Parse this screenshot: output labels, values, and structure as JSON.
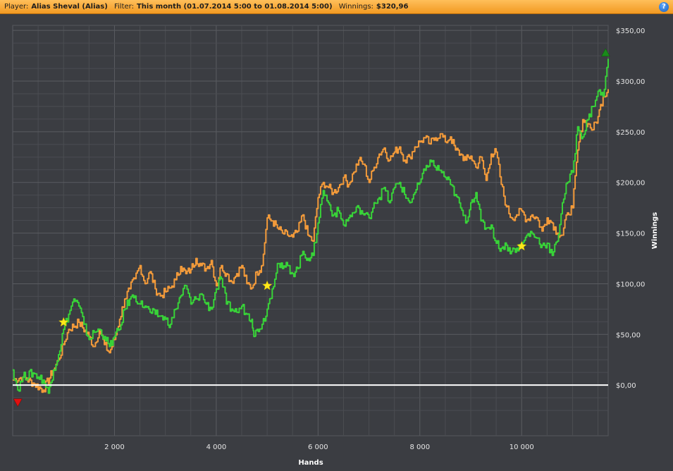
{
  "header": {
    "player_label": "Player:",
    "player_value": "Alias Sheval (Alias)",
    "filter_label": "Filter:",
    "filter_value": "This month (01.07.2014 5:00 to 01.08.2014 5:00)",
    "winnings_label": "Winnings:",
    "winnings_value": "$320,96",
    "help_icon": "?"
  },
  "colors": {
    "background": "#3b3d42",
    "grid": "#4b4d52",
    "orange_line": "#f29a3a",
    "green_line": "#38d238",
    "zero_line": "#ffffff",
    "star": "#ffe81a",
    "min_marker": "#e01010",
    "max_marker": "#1a8a1a"
  },
  "chart_data": {
    "type": "line",
    "xlabel": "Hands",
    "ylabel": "Winnings",
    "xlim": [
      0,
      11700
    ],
    "ylim": [
      -50,
      355
    ],
    "x_ticks": [
      2000,
      4000,
      6000,
      8000,
      10000
    ],
    "x_tick_labels": [
      "2 000",
      "4 000",
      "6 000",
      "8 000",
      "10 000"
    ],
    "y_ticks": [
      0,
      50,
      100,
      150,
      200,
      250,
      300,
      350
    ],
    "y_tick_labels": [
      "$0,00",
      "$50,00",
      "$100,00",
      "$150,00",
      "$200,00",
      "$250,00",
      "$300,00",
      "$350,00"
    ],
    "grid": true,
    "series": [
      {
        "color": "orange",
        "x": [
          0,
          200,
          400,
          600,
          800,
          900,
          1000,
          1100,
          1300,
          1500,
          1600,
          1700,
          1800,
          1900,
          2000,
          2100,
          2200,
          2300,
          2400,
          2500,
          2600,
          2700,
          2800,
          2900,
          3000,
          3100,
          3200,
          3300,
          3400,
          3500,
          3600,
          3700,
          3800,
          3900,
          4000,
          4100,
          4200,
          4300,
          4400,
          4500,
          4600,
          4700,
          4800,
          4850,
          4900,
          5000,
          5100,
          5200,
          5300,
          5400,
          5500,
          5600,
          5700,
          5800,
          5900,
          6000,
          6100,
          6200,
          6300,
          6400,
          6500,
          6600,
          6700,
          6800,
          6900,
          7000,
          7100,
          7200,
          7300,
          7400,
          7500,
          7600,
          7700,
          7800,
          7900,
          8000,
          8100,
          8200,
          8300,
          8400,
          8500,
          8600,
          8700,
          8800,
          8900,
          9000,
          9100,
          9200,
          9300,
          9400,
          9500,
          9600,
          9700,
          9800,
          9900,
          10000,
          10100,
          10200,
          10300,
          10400,
          10500,
          10600,
          10700,
          10800,
          10900,
          11000,
          11100,
          11200,
          11300,
          11400,
          11500,
          11600,
          11700
        ],
        "y": [
          5,
          8,
          2,
          -5,
          15,
          25,
          40,
          55,
          62,
          48,
          38,
          55,
          40,
          32,
          45,
          65,
          85,
          95,
          105,
          118,
          100,
          112,
          95,
          88,
          92,
          96,
          104,
          117,
          110,
          114,
          125,
          118,
          115,
          123,
          98,
          118,
          110,
          102,
          110,
          118,
          100,
          96,
          112,
          113,
          118,
          165,
          162,
          155,
          150,
          148,
          146,
          152,
          168,
          148,
          142,
          185,
          200,
          195,
          190,
          195,
          205,
          198,
          210,
          222,
          218,
          200,
          215,
          228,
          234,
          222,
          230,
          235,
          222,
          225,
          235,
          240,
          244,
          238,
          244,
          248,
          240,
          245,
          232,
          228,
          222,
          226,
          215,
          225,
          202,
          228,
          230,
          198,
          176,
          165,
          168,
          172,
          163,
          168,
          165,
          152,
          165,
          160,
          150,
          148,
          170,
          175,
          232,
          262,
          258,
          252,
          265,
          285,
          292
        ]
      },
      {
        "color": "green",
        "x": [
          0,
          100,
          200,
          400,
          600,
          700,
          800,
          900,
          1000,
          1100,
          1200,
          1300,
          1400,
          1500,
          1600,
          1700,
          1800,
          1900,
          2000,
          2100,
          2200,
          2300,
          2400,
          2500,
          2600,
          2700,
          2800,
          2900,
          3000,
          3100,
          3200,
          3300,
          3400,
          3500,
          3600,
          3700,
          3800,
          3900,
          4000,
          4100,
          4200,
          4300,
          4400,
          4500,
          4600,
          4700,
          4750,
          4800,
          4900,
          5000,
          5100,
          5200,
          5300,
          5400,
          5500,
          5600,
          5700,
          5800,
          5900,
          6000,
          6100,
          6200,
          6300,
          6400,
          6500,
          6600,
          6700,
          6800,
          6900,
          7000,
          7100,
          7200,
          7300,
          7400,
          7500,
          7600,
          7700,
          7800,
          7900,
          8000,
          8100,
          8200,
          8300,
          8400,
          8500,
          8600,
          8700,
          8800,
          8900,
          9000,
          9100,
          9200,
          9300,
          9400,
          9500,
          9600,
          9700,
          9800,
          9900,
          10000,
          10100,
          10200,
          10300,
          10400,
          10500,
          10600,
          10700,
          10800,
          10900,
          11000,
          11100,
          11200,
          11300,
          11400,
          11500,
          11600,
          11700
        ],
        "y": [
          15,
          -5,
          8,
          12,
          5,
          -8,
          15,
          30,
          55,
          70,
          85,
          78,
          60,
          45,
          52,
          55,
          48,
          38,
          48,
          55,
          75,
          85,
          88,
          80,
          78,
          72,
          70,
          68,
          65,
          60,
          75,
          88,
          98,
          80,
          85,
          90,
          80,
          75,
          95,
          105,
          80,
          75,
          72,
          78,
          70,
          65,
          48,
          55,
          60,
          75,
          95,
          120,
          115,
          118,
          110,
          115,
          132,
          125,
          128,
          160,
          192,
          180,
          168,
          172,
          158,
          165,
          170,
          175,
          168,
          165,
          180,
          185,
          195,
          180,
          195,
          200,
          188,
          180,
          190,
          200,
          212,
          222,
          215,
          212,
          205,
          198,
          188,
          175,
          160,
          180,
          190,
          162,
          155,
          158,
          140,
          135,
          138,
          132,
          135,
          137,
          148,
          150,
          145,
          138,
          140,
          128,
          142,
          180,
          200,
          210,
          255,
          245,
          262,
          275,
          290,
          285,
          322
        ]
      }
    ],
    "markers": [
      {
        "type": "star",
        "x": 1000,
        "y": 62
      },
      {
        "type": "star",
        "x": 5000,
        "y": 98
      },
      {
        "type": "star",
        "x": 10000,
        "y": 137
      },
      {
        "type": "min-triangle",
        "x": 100,
        "y": -17
      },
      {
        "type": "max-triangle",
        "x": 11650,
        "y": 328
      }
    ]
  }
}
